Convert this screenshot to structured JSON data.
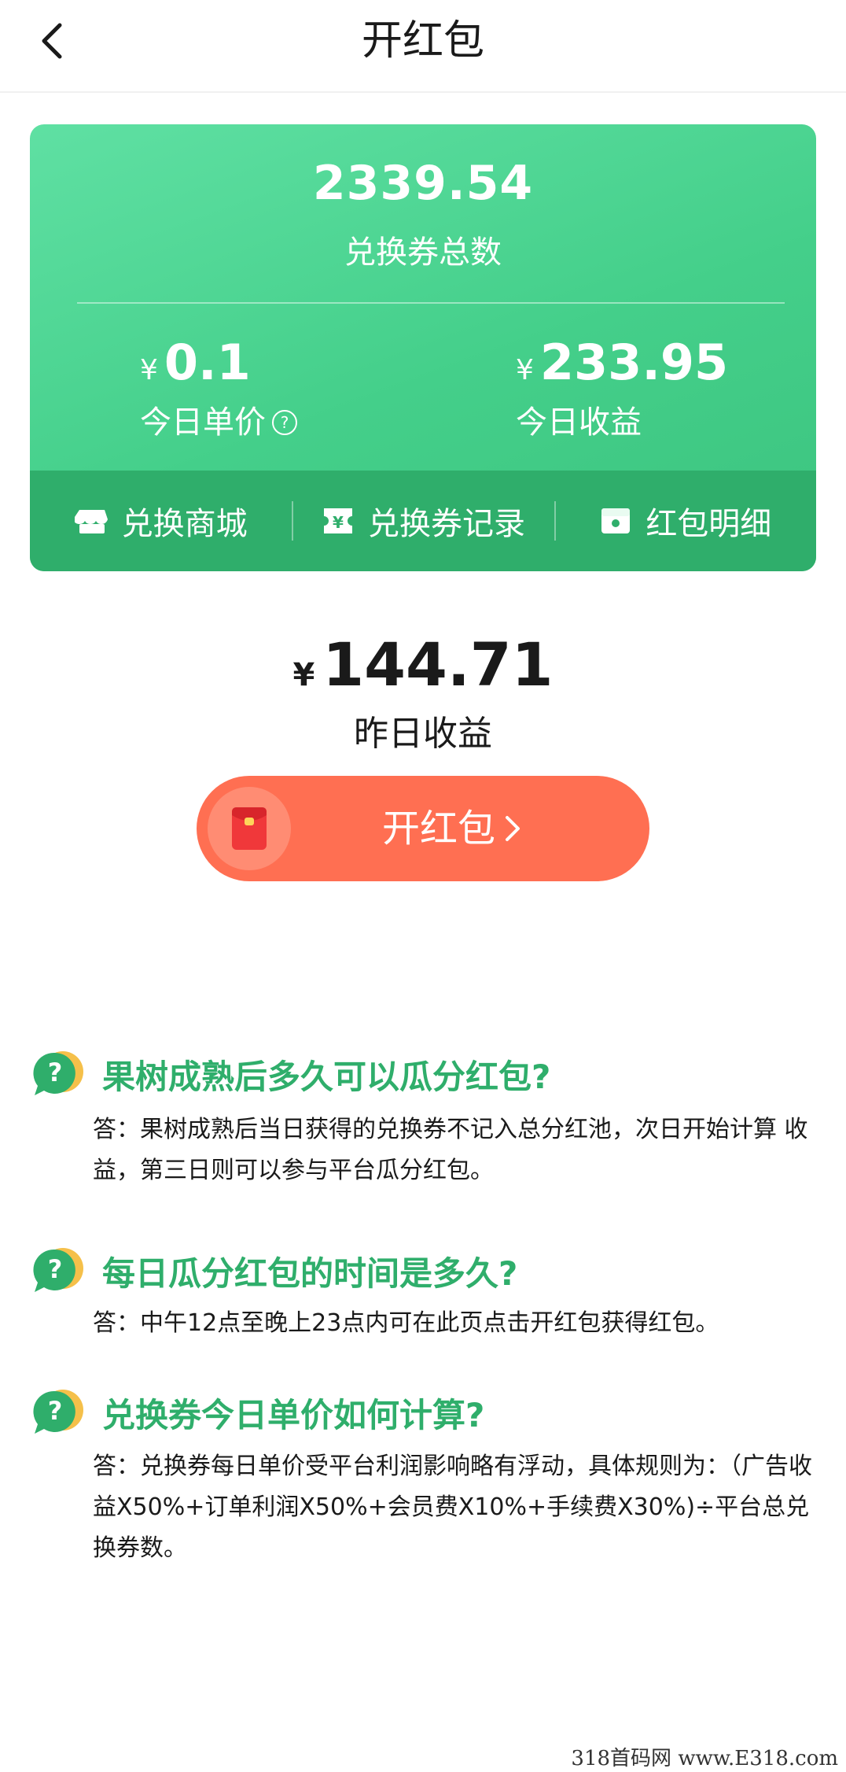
{
  "nav": {
    "title": "开红包"
  },
  "card": {
    "total_value": "2339.54",
    "total_label": "兑换券总数",
    "unit_price": {
      "currency": "¥",
      "value": "0.1",
      "label": "今日单价"
    },
    "today_income": {
      "currency": "¥",
      "value": "233.95",
      "label": "今日收益"
    },
    "actions": [
      {
        "label": "兑换商城",
        "icon": "shop-icon"
      },
      {
        "label": "兑换券记录",
        "icon": "coupon-icon"
      },
      {
        "label": "红包明细",
        "icon": "wallet-icon"
      }
    ]
  },
  "yesterday": {
    "currency": "¥",
    "value": "144.71",
    "label": "昨日收益"
  },
  "open_button": {
    "label": "开红包"
  },
  "faq": [
    {
      "question": "果树成熟后多久可以瓜分红包?",
      "answer": "答：果树成熟后当日获得的兑换券不记入总分红池，次日开始计算 收益，第三日则可以参与平台瓜分红包。"
    },
    {
      "question": "每日瓜分红包的时间是多久?",
      "answer": "答：中午12点至晚上23点内可在此页点击开红包获得红包。"
    },
    {
      "question": "兑换券今日单价如何计算?",
      "answer": "答：兑换券每日单价受平台利润影响略有浮动，具体规则为：（广告收益X50%+订单利润X50%+会员费X10%+手续费X30%)÷平台总兑换券数。"
    }
  ],
  "watermark": "318首码网 www.E318.com"
}
